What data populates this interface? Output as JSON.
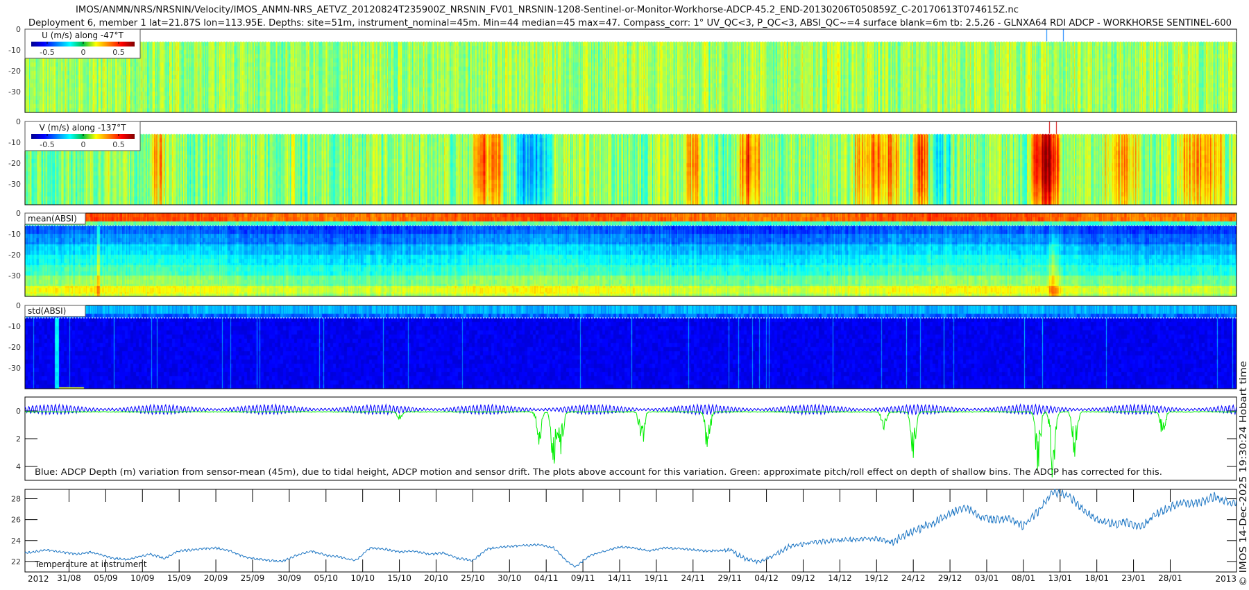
{
  "title": {
    "line1": "IMOS/ANMN/NRS/NRSNIN/Velocity/IMOS_ANMN-NRS_AETVZ_20120824T235900Z_NRSNIN_FV01_NRSNIN-1208-Sentinel-or-Monitor-Workhorse-ADCP-45.2_END-20130206T050859Z_C-20170613T074615Z.nc",
    "line2": "Deployment 6, member 1 lat=21.87S lon=113.95E. Depths: site=51m, instrument_nominal=45m. Min=44 median=45 max=47. Compass_corr: 1° UV_QC<3, P_QC<3, ABSI_QC~=4 surface blank=6m tb: 2.5.26 - GLNXA64 RDI ADCP - WORKHORSE SENTINEL-600"
  },
  "copyright": "© IMOS 14-Dec-2025 19:30:24 Hobart time",
  "x_axis": {
    "start_label": "2012",
    "end_label": "2013",
    "range": [
      "2012-08-25",
      "2013-02-06"
    ],
    "ticks": [
      "31/08",
      "05/09",
      "10/09",
      "15/09",
      "20/09",
      "25/09",
      "30/09",
      "05/10",
      "10/10",
      "15/10",
      "20/10",
      "25/10",
      "30/10",
      "04/11",
      "09/11",
      "14/11",
      "19/11",
      "24/11",
      "29/11",
      "04/12",
      "09/12",
      "14/12",
      "19/12",
      "24/12",
      "29/12",
      "03/01",
      "08/01",
      "13/01",
      "18/01",
      "23/01",
      "28/01"
    ]
  },
  "chart_data": [
    {
      "type": "heatmap",
      "label": "U (m/s) along -47°T",
      "ylim": [
        -40,
        0
      ],
      "yticks": [
        "0",
        "-10",
        "-20",
        "-30"
      ],
      "colormap": "jet",
      "colorbar": {
        "range": [
          -0.72,
          0.72
        ],
        "ticks": [
          "-0.5",
          "0",
          "0.5"
        ]
      },
      "surface_blank_m": 6,
      "typical_value": 0.05
    },
    {
      "type": "heatmap",
      "label": "V (m/s) along -137°T",
      "ylim": [
        -40,
        0
      ],
      "yticks": [
        "0",
        "-10",
        "-20",
        "-30"
      ],
      "colormap": "jet",
      "colorbar": {
        "range": [
          -0.72,
          0.72
        ],
        "ticks": [
          "-0.5",
          "0",
          "0.5"
        ]
      },
      "surface_blank_m": 6,
      "events": [
        {
          "from": "2012-09-11",
          "to": "2012-09-13",
          "value": 0.3
        },
        {
          "from": "2012-10-25",
          "to": "2012-10-29",
          "value": 0.35
        },
        {
          "from": "2012-10-31",
          "to": "2012-11-05",
          "value": -0.3
        },
        {
          "from": "2012-11-23",
          "to": "2012-11-25",
          "value": 0.3
        },
        {
          "from": "2012-11-30",
          "to": "2012-12-03",
          "value": 0.4
        },
        {
          "from": "2012-12-16",
          "to": "2012-12-22",
          "value": 0.35
        },
        {
          "from": "2012-12-24",
          "to": "2012-12-26",
          "value": 0.45
        },
        {
          "from": "2012-12-26",
          "to": "2012-12-29",
          "value": -0.2
        },
        {
          "from": "2013-01-09",
          "to": "2013-01-13",
          "value": 0.6
        },
        {
          "from": "2013-01-19",
          "to": "2013-01-24",
          "value": 0.25
        },
        {
          "from": "2013-01-29",
          "to": "2013-02-04",
          "value": 0.3
        }
      ]
    },
    {
      "type": "heatmap",
      "label": "mean(ABSI)",
      "ylim": [
        -40,
        0
      ],
      "yticks": [
        "0",
        "-10",
        "-20",
        "-30"
      ],
      "colormap": "jet",
      "surface_blank_m": 6
    },
    {
      "type": "heatmap",
      "label": "std(ABSI)",
      "ylim": [
        -40,
        0
      ],
      "yticks": [
        "0",
        "-10",
        "-20",
        "-30"
      ],
      "colormap": "jet",
      "surface_blank_m": 6
    },
    {
      "type": "line",
      "caption": "Blue: ADCP Depth (m) variation from sensor-mean (45m), due to tidal height, ADCP motion and sensor drift. The plots above account for this variation. Green: approximate pitch/roll effect on depth of shallow bins. The ADCP has corrected for this.",
      "ylim": [
        -1,
        5
      ],
      "yticks": [
        "0",
        "2",
        "4"
      ],
      "series": [
        {
          "color": "#0000ff",
          "range": [
            -0.6,
            0.4
          ]
        },
        {
          "color": "#00ee00",
          "dips": [
            {
              "date": "2012-10-15",
              "depth": 0.6
            },
            {
              "date": "2012-11-03",
              "depth": 2.5
            },
            {
              "date": "2012-11-05",
              "depth": 4.2
            },
            {
              "date": "2012-11-06",
              "depth": 3.0
            },
            {
              "date": "2012-11-17",
              "depth": 3.0
            },
            {
              "date": "2012-11-26",
              "depth": 3.5
            },
            {
              "date": "2012-12-20",
              "depth": 1.5
            },
            {
              "date": "2012-12-24",
              "depth": 3.5
            },
            {
              "date": "2013-01-10",
              "depth": 4.8
            },
            {
              "date": "2013-01-12",
              "depth": 5.0
            },
            {
              "date": "2013-01-15",
              "depth": 3.4
            },
            {
              "date": "2013-01-27",
              "depth": 2.0
            }
          ]
        }
      ]
    },
    {
      "type": "line",
      "label": "Temperature at instrument",
      "ylim": [
        21.0,
        28.9
      ],
      "yticks": [
        "22",
        "24",
        "26",
        "28"
      ],
      "color": "#1f77c4",
      "x": [
        "2012-08-25",
        "2012-08-28",
        "2012-09-01",
        "2012-09-03",
        "2012-09-06",
        "2012-09-08",
        "2012-09-11",
        "2012-09-13",
        "2012-09-15",
        "2012-09-18",
        "2012-09-20",
        "2012-09-22",
        "2012-09-24",
        "2012-09-26",
        "2012-09-29",
        "2012-10-01",
        "2012-10-03",
        "2012-10-05",
        "2012-10-07",
        "2012-10-09",
        "2012-10-11",
        "2012-10-13",
        "2012-10-15",
        "2012-10-17",
        "2012-10-19",
        "2012-10-21",
        "2012-10-23",
        "2012-10-25",
        "2012-10-27",
        "2012-10-29",
        "2012-10-31",
        "2012-11-03",
        "2012-11-05",
        "2012-11-07",
        "2012-11-08",
        "2012-11-10",
        "2012-11-12",
        "2012-11-14",
        "2012-11-16",
        "2012-11-18",
        "2012-11-20",
        "2012-11-23",
        "2012-11-26",
        "2012-11-29",
        "2012-12-01",
        "2012-12-03",
        "2012-12-05",
        "2012-12-07",
        "2012-12-10",
        "2012-12-13",
        "2012-12-16",
        "2012-12-19",
        "2012-12-21",
        "2012-12-23",
        "2012-12-25",
        "2012-12-27",
        "2012-12-29",
        "2012-12-31",
        "2013-01-02",
        "2013-01-04",
        "2013-01-06",
        "2013-01-08",
        "2013-01-10",
        "2013-01-12",
        "2013-01-14",
        "2013-01-16",
        "2013-01-18",
        "2013-01-20",
        "2013-01-22",
        "2013-01-24",
        "2013-01-26",
        "2013-01-28",
        "2013-01-30",
        "2013-02-01",
        "2013-02-03",
        "2013-02-05"
      ],
      "values": [
        22.8,
        23.1,
        22.7,
        22.9,
        22.3,
        22.2,
        22.7,
        22.3,
        23.0,
        23.2,
        23.3,
        23.0,
        22.4,
        22.2,
        22.0,
        22.6,
        23.0,
        22.6,
        22.4,
        22.1,
        23.3,
        23.2,
        22.9,
        23.0,
        22.7,
        22.8,
        22.3,
        22.1,
        23.2,
        23.4,
        23.5,
        23.6,
        23.3,
        21.9,
        21.5,
        22.6,
        23.0,
        23.4,
        23.3,
        23.0,
        23.3,
        23.2,
        23.0,
        23.1,
        22.3,
        21.9,
        22.6,
        23.4,
        23.8,
        24.0,
        24.1,
        24.2,
        23.8,
        24.6,
        25.2,
        25.8,
        26.6,
        27.2,
        26.3,
        26.0,
        26.1,
        25.4,
        26.8,
        28.6,
        28.4,
        27.0,
        26.0,
        25.6,
        25.7,
        25.3,
        26.6,
        27.2,
        27.6,
        27.6,
        28.2,
        27.6
      ]
    }
  ]
}
